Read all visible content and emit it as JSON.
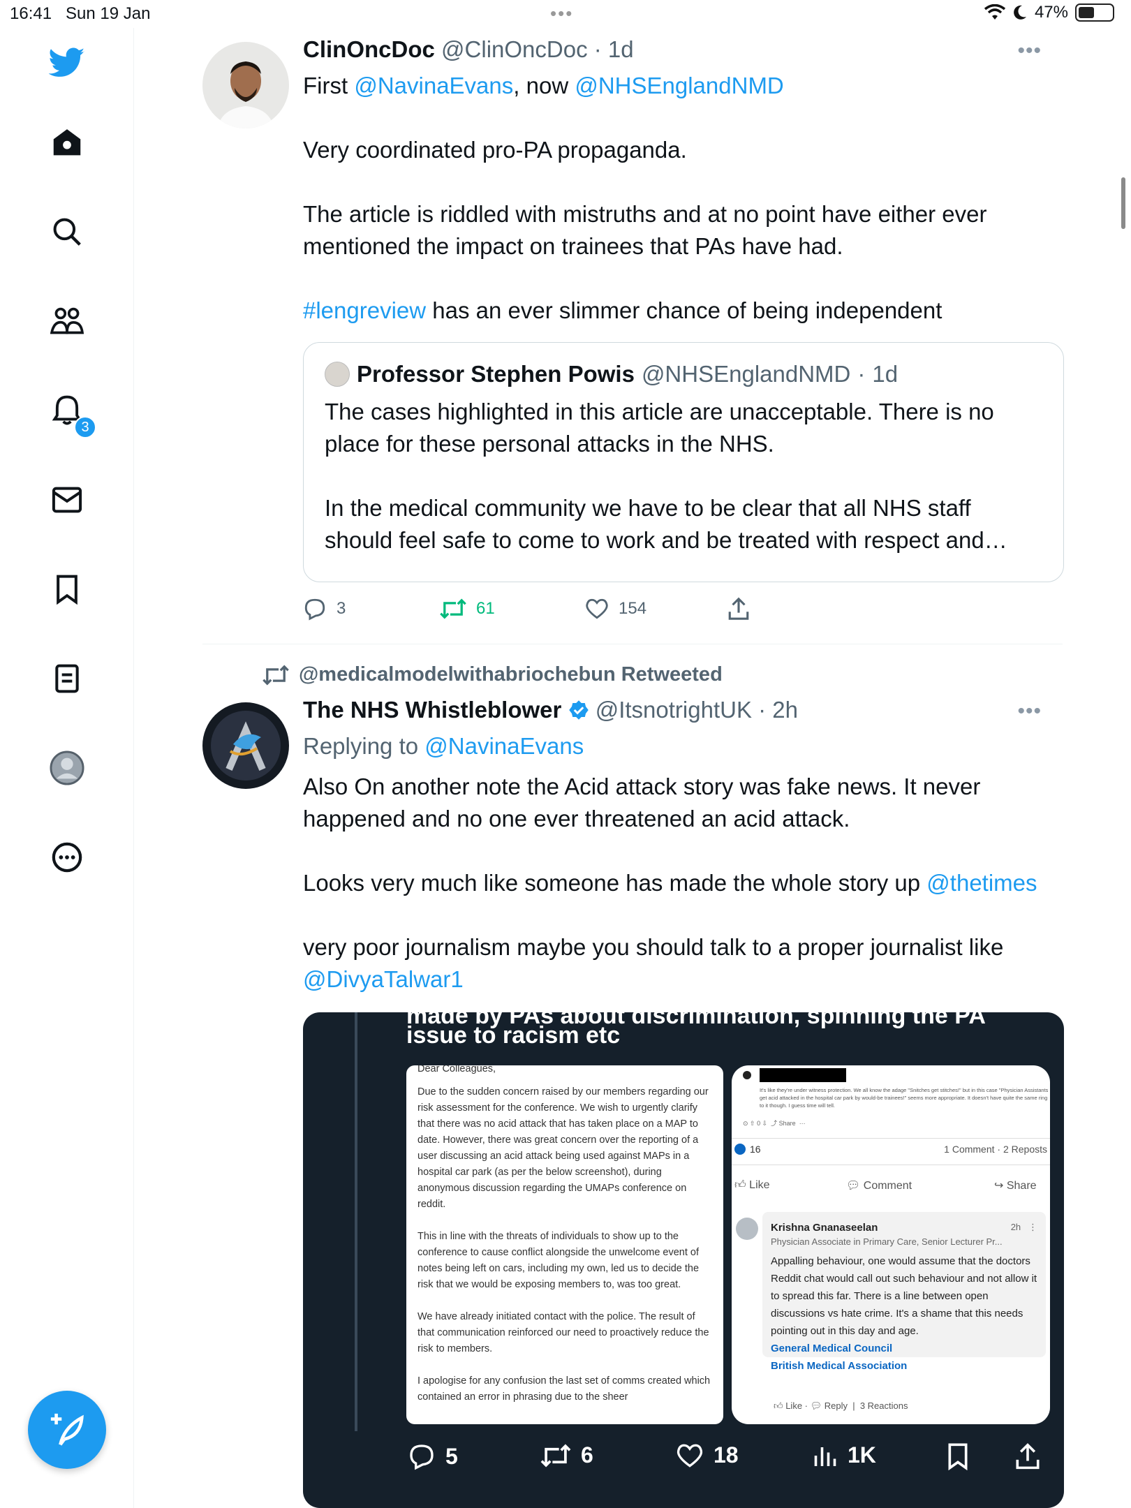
{
  "status_bar": {
    "time": "16:41",
    "date": "Sun 19 Jan",
    "battery": "47%"
  },
  "nav": {
    "notification_count": "3"
  },
  "tweet1": {
    "name": "ClinOncDoc",
    "handle": "@ClinOncDoc",
    "age": "1d",
    "line1_prefix": "First ",
    "mention1": "@NavinaEvans",
    "line1_mid": ", now ",
    "mention2": "@NHSEnglandNMD",
    "para2": "Very coordinated pro-PA propaganda.",
    "para3_l1": "The article is riddled with mistruths and at no point have either ever",
    "para3_l2": "mentioned the impact on trainees that PAs have had.",
    "hashtag": "#lengreview",
    "para4_rest": " has an ever slimmer chance of being independent",
    "quote": {
      "name": "Professor Stephen Powis",
      "handle": "@NHSEnglandNMD",
      "age": "1d",
      "l1": "The cases highlighted in this article are unacceptable. There is no",
      "l2": "place for these personal attacks in the NHS.",
      "l3": "In the medical community we have to be clear that all NHS staff",
      "l4": "should feel safe to come to work and be treated with respect and…"
    },
    "replies": "3",
    "retweets": "61",
    "likes": "154"
  },
  "tweet2": {
    "retweeted_by": "@medicalmodelwithabriochebun Retweeted",
    "name": "The NHS Whistleblower",
    "handle": "@ItsnotrightUK",
    "age": "2h",
    "replying_prefix": "Replying to ",
    "replying_to": "@NavinaEvans",
    "p1_l1": "Also On another note the Acid attack story was fake news. It never",
    "p1_l2": "happened and no one ever threatened an acid attack.",
    "p2_text": "Looks very much like someone has made the whole story up ",
    "p2_mention": "@thetimes",
    "p3_l1": "very poor journalism maybe you should talk to a proper journalist like",
    "p3_mention": "@DivyaTalwar1",
    "media": {
      "cut_line": "made by PAs about discrimination, spinning the PA",
      "title": "issue to racism etc",
      "letter": {
        "greeting": "Dear Colleagues,",
        "p1": "Due to the sudden concern raised by our members regarding our risk assessment for the conference. We wish to urgently clarify that there was no acid attack that has taken place on a MAP to date. However, there was great concern over the reporting of a user discussing an acid attack being used against MAPs in a hospital car park (as per the below screenshot), during anonymous discussion regarding the UMAPs conference on reddit.",
        "p2": "This in line with the threats of individuals to show up to the conference to cause conflict alongside the unwelcome event of notes being left on cars, including my own, led us to decide the risk that we would be exposing members to, was too great.",
        "p3": "We have already initiated contact with the police. The result of that communication reinforced our need to proactively reduce the risk to members.",
        "p4": "I apologise for any confusion the last set of comms created which contained an error in phrasing due to the sheer"
      },
      "post": {
        "reddit_quote": "It's like they're under witness protection. We all know the adage \"Snitches get stitches!\" but in this case \"Physician Assistants get acid attacked in the hospital car park by would-be trainees!\" seems more appropriate. It doesn't have quite the same ring to it though. I guess time will tell.",
        "reddit_meta": "0",
        "share": "Share",
        "reactions_count": "16",
        "comments_reposts": "1 Comment · 2 Reposts",
        "like": "Like",
        "comment": "Comment",
        "share_btn": "Share",
        "commenter_name": "Krishna Gnanaseelan",
        "commenter_time": "2h",
        "commenter_title": "Physician Associate in Primary Care, Senior Lecturer Pr...",
        "comment_text": "Appalling behaviour, one would assume that the doctors Reddit chat would call out such behaviour and not allow it to spread this far. There is a line between open discussions vs hate crime. It's a shame that this needs pointing out in this day and age.",
        "tag1": "General Medical Council",
        "tag2": "British Medical Association",
        "c_like": "Like",
        "c_reply": "Reply",
        "c_reactions": "3 Reactions"
      }
    },
    "replies": "5",
    "retweets": "6",
    "likes": "18",
    "views": "1K"
  },
  "colors": {
    "accent": "#1d9bf0",
    "retweet_green": "#00ba7c",
    "text": "#0f1419",
    "muted": "#536471"
  }
}
